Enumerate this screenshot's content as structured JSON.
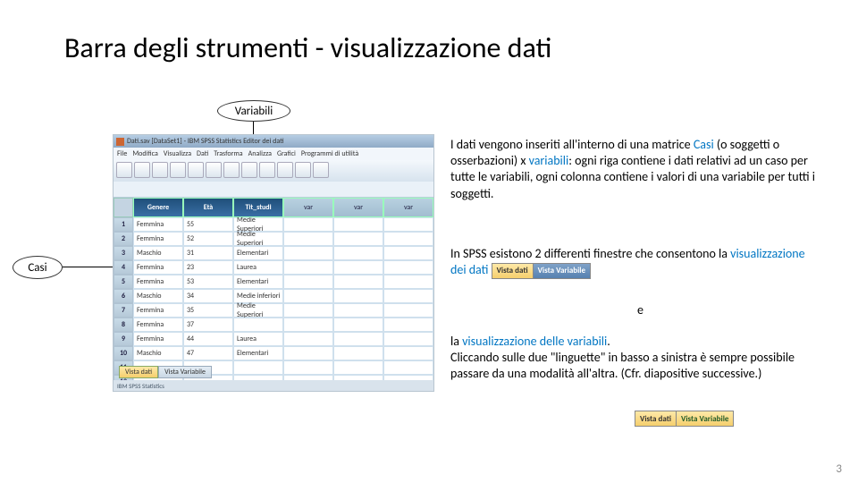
{
  "title": "Barra degli strumenti - visualizzazione dati",
  "page_number": "3",
  "bubbles": {
    "variabili": "Variabili",
    "casi": "Casi"
  },
  "spss": {
    "window_title": "Dati.sav [DataSet1] - IBM SPSS Statistics Editor dei dati",
    "menu": [
      "File",
      "Modifica",
      "Visualizza",
      "Dati",
      "Trasforma",
      "Analizza",
      "Grafici",
      "Programmi di utilità"
    ],
    "columns_named": [
      "Genere",
      "Età",
      "Tit_studi"
    ],
    "columns_empty": [
      "var",
      "var",
      "var"
    ],
    "rows": [
      [
        "Femmina",
        "55",
        "Medie Superiori"
      ],
      [
        "Femmina",
        "52",
        "Medie Superiori"
      ],
      [
        "Maschio",
        "31",
        "Elementari"
      ],
      [
        "Femmina",
        "23",
        "Laurea"
      ],
      [
        "Femmina",
        "53",
        "Elementari"
      ],
      [
        "Maschio",
        "34",
        "Medie inferiori"
      ],
      [
        "Femmina",
        "35",
        "Medie Superiori"
      ],
      [
        "Femmina",
        "37",
        ""
      ],
      [
        "Femmina",
        "44",
        "Laurea"
      ],
      [
        "Maschio",
        "47",
        "Elementari"
      ],
      [
        "",
        "",
        ""
      ],
      [
        "",
        "",
        ""
      ],
      [
        "",
        "",
        ""
      ],
      [
        "",
        "",
        ""
      ]
    ],
    "tabs": {
      "data": "Vista dati",
      "vars": "Vista Variabile"
    },
    "status": "IBM SPSS Statistics"
  },
  "body": {
    "p1a": "I dati vengono inseriti all'interno di una matrice ",
    "p1_casi": "Casi",
    "p1b": " (o soggetti o osserbazioni) x ",
    "p1_var": "variabili",
    "p1c": ": ogni riga contiene i dati relativi ad un caso per tutte le variabili, ogni colonna contiene i valori di una variabile per tutti i soggetti.",
    "p2a": "In SPSS esistono 2 differenti finestre che consentono la ",
    "p2_vis": "visualizzazione dei dati",
    "e": "e",
    "p3a": "la ",
    "p3_vis": "visualizzazione delle variabili",
    "p3b": ".",
    "p3c": "Cliccando sulle due \"linguette\" in basso a sinistra è sempre possibile passare da una modalità all'altra. (Cfr. diapositive successive.)",
    "mini": {
      "l": "Vista dati",
      "r": "Vista Variabile"
    }
  }
}
